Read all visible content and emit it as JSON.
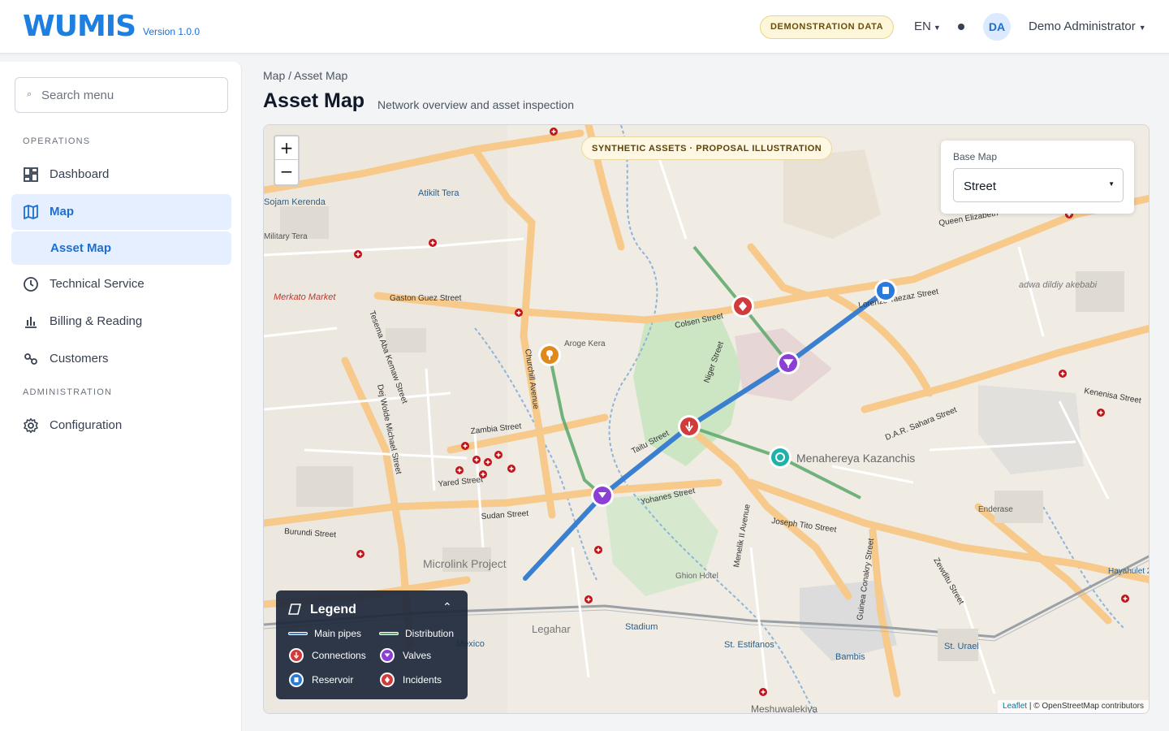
{
  "header": {
    "logo": "WUMIS",
    "version": "Version 1.0.0",
    "demo_badge": "DEMONSTRATION DATA",
    "language": "EN",
    "avatar_initials": "DA",
    "user_name": "Demo Administrator"
  },
  "sidebar": {
    "search_placeholder": "Search menu",
    "sections": {
      "operations": "OPERATIONS",
      "administration": "ADMINISTRATION"
    },
    "items": [
      {
        "label": "Dashboard",
        "icon": "dashboard-icon"
      },
      {
        "label": "Map",
        "icon": "map-icon",
        "active": true
      },
      {
        "label": "Asset Map",
        "icon": "",
        "sub": true,
        "active": true
      },
      {
        "label": "Technical Service",
        "icon": "clock-icon"
      },
      {
        "label": "Billing & Reading",
        "icon": "bar-chart-icon"
      },
      {
        "label": "Customers",
        "icon": "users-icon"
      },
      {
        "label": "Configuration",
        "icon": "gear-icon"
      }
    ]
  },
  "main": {
    "breadcrumb": "Map / Asset Map",
    "title": "Asset Map",
    "subtitle": "Network overview and asset inspection"
  },
  "map": {
    "banner": "SYNTHETIC ASSETS · PROPOSAL ILLUSTRATION",
    "zoom_in": "+",
    "zoom_out": "−",
    "base_map_label": "Base Map",
    "base_map_value": "Street",
    "legend": {
      "title": "Legend",
      "items": [
        {
          "label": "Main pipes",
          "color": "#3a7fd0"
        },
        {
          "label": "Distribution",
          "color": "#5aa86a"
        },
        {
          "label": "Connections",
          "color": "#d13b3b"
        },
        {
          "label": "Valves",
          "color": "#8b3fd6"
        },
        {
          "label": "Reservoir",
          "color": "#2a7ad9"
        },
        {
          "label": "Incidents",
          "color": "#d13b3b"
        }
      ]
    },
    "attribution_link": "Leaflet",
    "attribution_text": "| © OpenStreetMap contributors",
    "colors": {
      "main_pipe": "#3a7fd0",
      "distribution": "#5aa86a",
      "connection": "#d13b3b",
      "valve": "#8b3fd6",
      "reservoir": "#2a7ad9",
      "incident": "#d13b3b",
      "pump": "#e08a1e",
      "meter": "#20b2aa"
    },
    "street_labels": [
      "Gaston Guez Street",
      "Colsen Street",
      "Zambia Street",
      "Yared Street",
      "Sudan Street",
      "Burundi Street",
      "Yohanes Street",
      "Taitu Street",
      "Joseph Tito Street",
      "Menelik II Avenue",
      "Churchill Avenue",
      "Queen Elizabeth",
      "Lorenzo Taezaz Street",
      "D.A.R. Sahara Street",
      "Niger Street",
      "Dej Wolde Michael Street",
      "Tesema Aba Kemaw Street",
      "Guinea Conakry Street",
      "Zewditu Street",
      "Kenenisa Street"
    ],
    "place_labels": [
      "Merkato Market",
      "Menahereya Kazanchis",
      "Microlink Project",
      "Legahar",
      "Stadium",
      "St. Estifanos",
      "Bambis",
      "St. Urael",
      "Mexico",
      "Ghion Hotel",
      "Sojam Kerenda",
      "Military Tera",
      "Atikilt Tera",
      "adwa dildiy akebabi",
      "Hayahulet 2",
      "Meshuwalekiya",
      "Enderase",
      "Aroge Kera"
    ]
  }
}
